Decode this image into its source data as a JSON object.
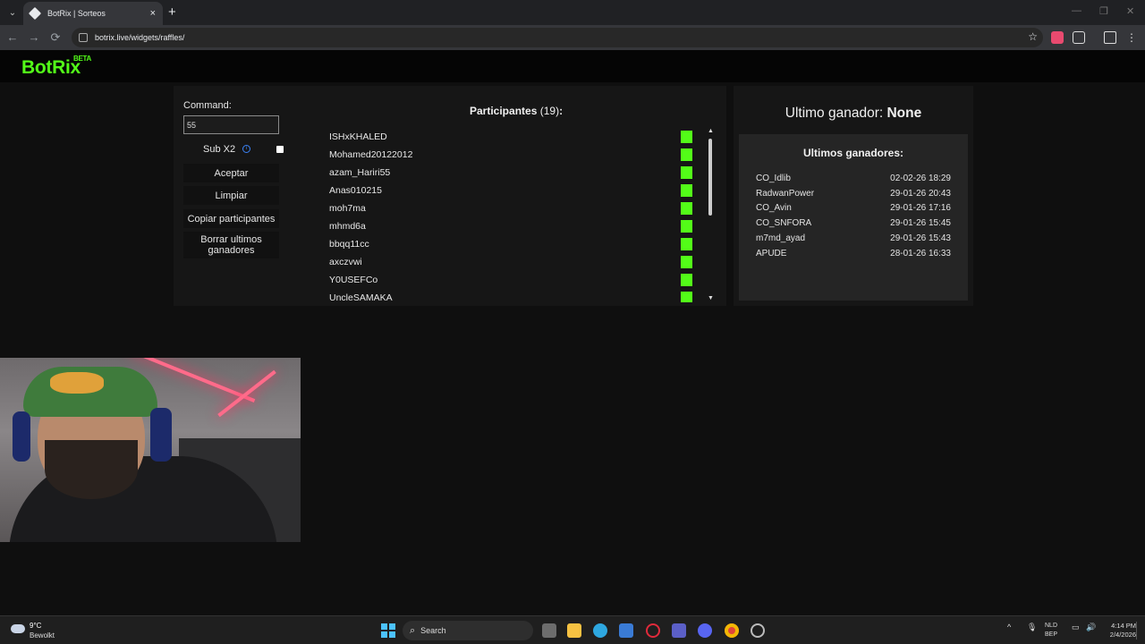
{
  "browser": {
    "tab_title": "BotRix | Sorteos",
    "tab_close": "×",
    "new_tab": "+",
    "url": "botrix.live/widgets/raffles/",
    "back": "←",
    "forward": "→",
    "reload": "⟳",
    "star": "☆",
    "min": "—",
    "max": "❐",
    "close": "✕",
    "tab_list": "⌄"
  },
  "site": {
    "logo": "BotRix",
    "logo_badge": "BETA"
  },
  "controls": {
    "command_label": "Command:",
    "command_value": "55",
    "sub_label": "Sub X2",
    "info": "i",
    "accept": "Aceptar",
    "clear": "Limpiar",
    "copy_participants": "Copiar participantes",
    "clear_winners": "Borrar ultimos ganadores"
  },
  "participants": {
    "title": "Participantes",
    "count": "(19)",
    "colon": ":",
    "items": [
      "ISHxKHALED",
      "Mohamed20122012",
      "azam_Hariri55",
      "Anas010215",
      "moh7ma",
      "mhmd6a",
      "bbqq11cc",
      "axczvwi",
      "Y0USEFCo",
      "UncleSAMAKA"
    ],
    "scroll_up": "▲",
    "scroll_down": "▼"
  },
  "winners": {
    "last_label": "Ultimo ganador:",
    "last_value": "None",
    "title": "Ultimos ganadores:",
    "rows": [
      {
        "name": "CO_Idlib",
        "date": "02-02-26 18:29"
      },
      {
        "name": "RadwanPower",
        "date": "29-01-26 20:43"
      },
      {
        "name": "CO_Avin",
        "date": "29-01-26 17:16"
      },
      {
        "name": "CO_SNFORA",
        "date": "29-01-26 15:45"
      },
      {
        "name": "m7md_ayad",
        "date": "29-01-26 15:43"
      },
      {
        "name": "APUDE",
        "date": "28-01-26 16:33"
      }
    ]
  },
  "taskbar": {
    "temp": "9°C",
    "condition": "Bewolkt",
    "search": "Search",
    "lang1": "NLD",
    "lang2": "BEP",
    "time": "4:14 PM",
    "date": "2/4/2026",
    "tray_up": "^"
  },
  "colors": {
    "kick_green": "#53fc18",
    "panel_bg": "#161616",
    "winner_box_bg": "#252525"
  }
}
